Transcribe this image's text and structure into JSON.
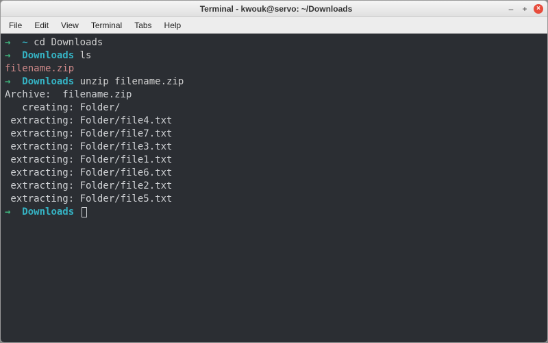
{
  "titlebar": {
    "title": "Terminal - kwouk@servo: ~/Downloads"
  },
  "window_controls": {
    "minimize_glyph": "–",
    "maximize_glyph": "+",
    "close_glyph": "×"
  },
  "menubar": {
    "items": [
      "File",
      "Edit",
      "View",
      "Terminal",
      "Tabs",
      "Help"
    ]
  },
  "prompt": {
    "arrow": "→"
  },
  "session": [
    {
      "type": "prompt",
      "cwd": "~",
      "cmd": "cd Downloads"
    },
    {
      "type": "prompt",
      "cwd": "Downloads",
      "cmd": "ls"
    },
    {
      "type": "output_zip",
      "text": "filename.zip"
    },
    {
      "type": "prompt",
      "cwd": "Downloads",
      "cmd": "unzip filename.zip"
    },
    {
      "type": "output",
      "text": "Archive:  filename.zip"
    },
    {
      "type": "output",
      "text": "   creating: Folder/"
    },
    {
      "type": "output",
      "text": " extracting: Folder/file4.txt"
    },
    {
      "type": "output",
      "text": " extracting: Folder/file7.txt"
    },
    {
      "type": "output",
      "text": " extracting: Folder/file3.txt"
    },
    {
      "type": "output",
      "text": " extracting: Folder/file1.txt"
    },
    {
      "type": "output",
      "text": " extracting: Folder/file6.txt"
    },
    {
      "type": "output",
      "text": " extracting: Folder/file2.txt"
    },
    {
      "type": "output",
      "text": " extracting: Folder/file5.txt"
    },
    {
      "type": "prompt",
      "cwd": "Downloads",
      "cmd": "",
      "cursor": true
    }
  ]
}
